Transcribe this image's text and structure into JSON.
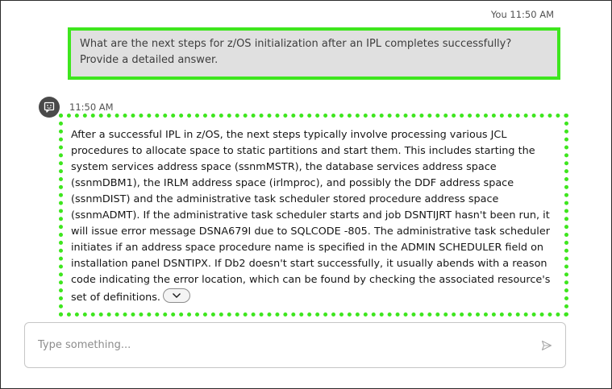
{
  "user_message": {
    "sender": "You",
    "time": "11:50 AM",
    "text": "What are the next steps for z/OS initialization after an IPL completes successfully? Provide a detailed answer."
  },
  "bot_message": {
    "time": "11:50 AM",
    "avatar_icon": "chat-bot-icon",
    "text": "After a successful IPL in z/OS, the next steps typically involve processing various JCL procedures to allocate space to static partitions and start them. This includes starting the system services address space (ssnmMSTR), the database services address space (ssnmDBM1), the IRLM address space (irlmproc), and possibly the DDF address space (ssnmDIST) and the administrative task scheduler stored procedure address space (ssnmADMT). If the administrative task scheduler starts and job DSNTIJRT hasn't been run, it will issue error message DSNA679I due to SQLCODE -805. The administrative task scheduler initiates if an address space procedure name is specified in the ADMIN SCHEDULER field on installation panel DSNTIPX. If Db2 doesn't start successfully, it usually abends with a reason code indicating the error location, which can be found by checking the associated resource's set of definitions.",
    "expand_icon": "chevron-down-icon"
  },
  "composer": {
    "placeholder": "Type something...",
    "send_icon": "send-icon"
  },
  "colors": {
    "highlight_border": "#3ee61e",
    "user_bubble": "#e0e0e0",
    "avatar_bg": "#4a4a4a"
  }
}
